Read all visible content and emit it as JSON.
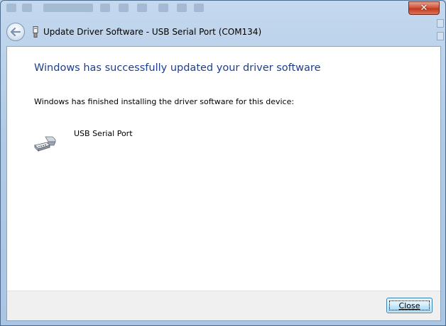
{
  "window": {
    "title": "Update Driver Software - USB Serial Port (COM134)",
    "close_glyph": "✕"
  },
  "content": {
    "heading": "Windows has successfully updated your driver software",
    "message": "Windows has finished installing the driver software for this device:",
    "device_name": "USB Serial Port"
  },
  "footer": {
    "close_label": "Close"
  },
  "icons": {
    "back": "back-arrow-icon",
    "usb_small": "usb-connector-icon",
    "device": "serial-port-icon"
  },
  "colors": {
    "heading": "#1e3f8f",
    "frame": "#b1cbe6",
    "close_x": "#c23a1e"
  }
}
